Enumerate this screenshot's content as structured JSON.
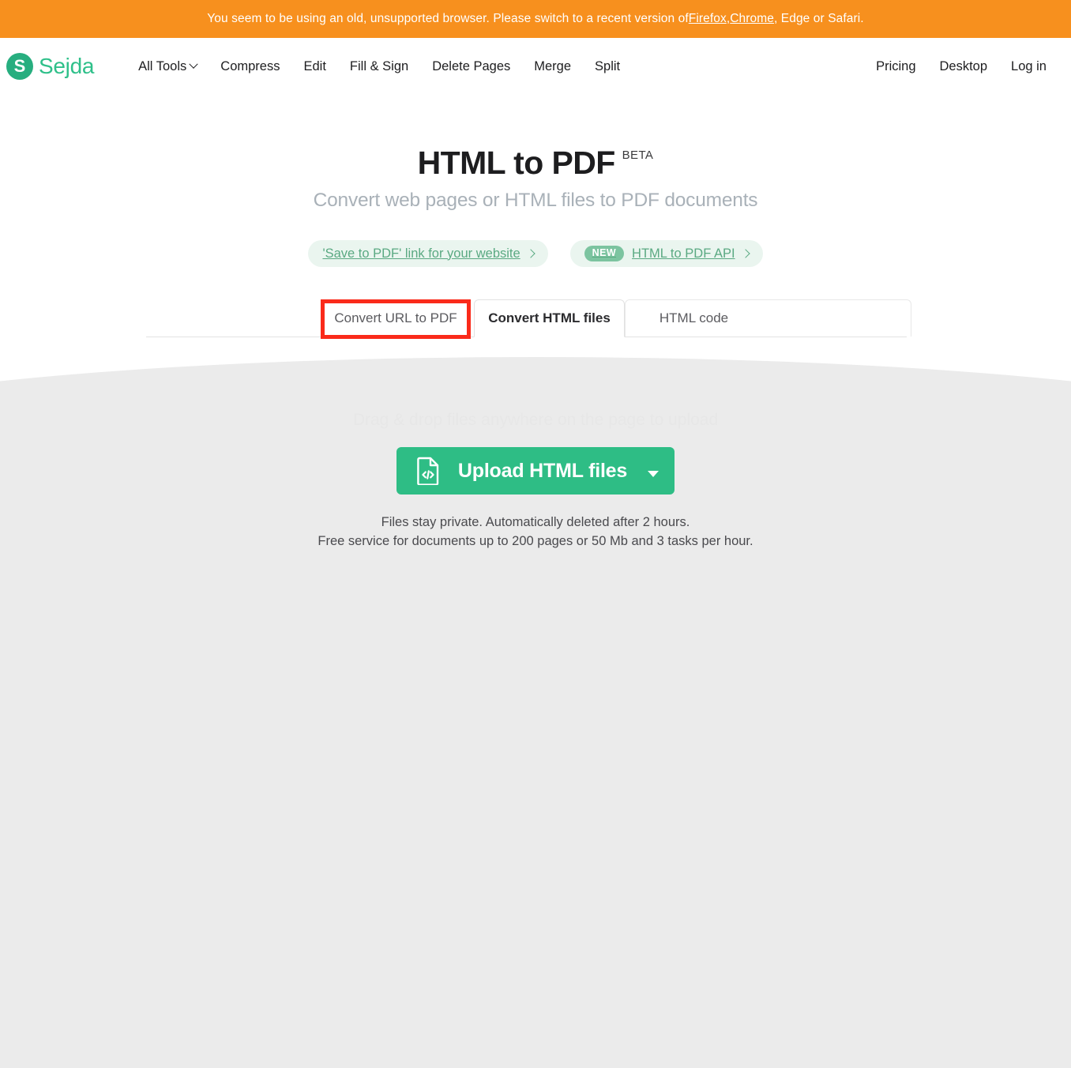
{
  "banner": {
    "text_before": "You seem to be using an old, unsupported browser. Please switch to a recent version of ",
    "link_firefox": "Firefox",
    "separator_1": ", ",
    "link_chrome": "Chrome",
    "text_after": ", Edge or Safari.",
    "background_color": "#f7901e"
  },
  "header": {
    "logo_letter": "S",
    "logo_text": "Sejda",
    "brand_color": "#2fc08a",
    "nav": [
      {
        "label": "All Tools",
        "has_chevron": true
      },
      {
        "label": "Compress",
        "has_chevron": false
      },
      {
        "label": "Edit",
        "has_chevron": false
      },
      {
        "label": "Fill & Sign",
        "has_chevron": false
      },
      {
        "label": "Delete Pages",
        "has_chevron": false
      },
      {
        "label": "Merge",
        "has_chevron": false
      },
      {
        "label": "Split",
        "has_chevron": false
      }
    ],
    "right_nav": [
      {
        "label": "Pricing"
      },
      {
        "label": "Desktop"
      },
      {
        "label": "Log in"
      }
    ]
  },
  "hero": {
    "title": "HTML to PDF",
    "badge": "BETA",
    "subtitle": "Convert web pages or HTML files to PDF documents"
  },
  "promos": [
    {
      "label": "'Save to PDF' link for your website",
      "badge": null,
      "arrow": "›"
    },
    {
      "label": "HTML to PDF API",
      "badge": "NEW",
      "arrow": "›"
    }
  ],
  "tabs": {
    "items": [
      {
        "label": "Convert URL to PDF",
        "active": false
      },
      {
        "label": "Convert HTML files",
        "active": true
      },
      {
        "label": "HTML code",
        "active": false
      }
    ],
    "highlighted_index": 0,
    "highlight_color": "#fa2a1a"
  },
  "dropzone": {
    "hint": "Drag & drop files anywhere on the page to upload"
  },
  "upload": {
    "label": "Upload HTML files",
    "icon": "file-code-icon",
    "has_dropdown": true,
    "background_color": "#2ebd85"
  },
  "privacy": {
    "line1": "Files stay private. Automatically deleted after 2 hours.",
    "line2": "Free service for documents up to 200 pages or 50 Mb and 3 tasks per hour."
  }
}
